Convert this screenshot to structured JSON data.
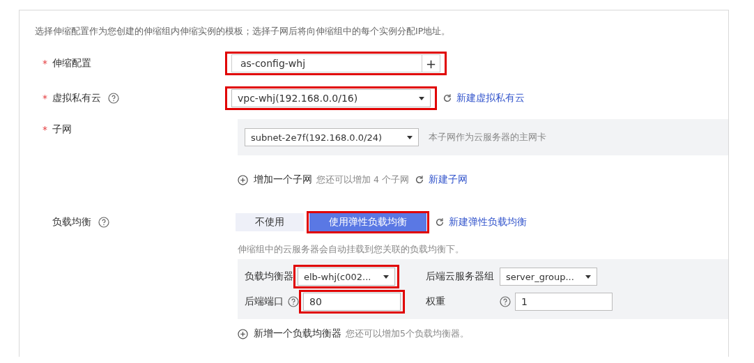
{
  "intro": "选择伸缩配置作为您创建的伸缩组内伸缩实例的模板；选择子网后将向伸缩组中的每个实例分配IP地址。",
  "config": {
    "label": "伸缩配置",
    "required_mark": "*",
    "value": "as-config-whj",
    "add": "+",
    "highlighted": true
  },
  "vpc": {
    "label": "虚拟私有云",
    "required_mark": "*",
    "value": "vpc-whj(192.168.0.0/16)",
    "link": "新建虚拟私有云",
    "highlighted": true
  },
  "subnet": {
    "label": "子网",
    "required_mark": "*",
    "value": "subnet-2e7f(192.168.0.0/24)",
    "hint": "本子网作为云服务器的主网卡",
    "add_label": "增加一个子网",
    "add_hint": "您还可以增加 4 个子网",
    "link": "新建子网"
  },
  "load_balance": {
    "label": "负载均衡",
    "options": [
      {
        "label": "不使用",
        "selected": false,
        "highlighted": false
      },
      {
        "label": "使用弹性负载均衡",
        "selected": true,
        "highlighted": true
      }
    ],
    "link": "新建弹性负载均衡",
    "hint": "伸缩组中的云服务器会自动挂载到您关联的负载均衡下。",
    "fields": [
      {
        "kind": "select",
        "label": "负载均衡器",
        "help": false,
        "value": "elb-whj(c002...",
        "highlighted": true
      },
      {
        "kind": "select",
        "label": "后端云服务器组",
        "help": false,
        "value": "server_group...",
        "highlighted": false
      },
      {
        "kind": "input",
        "label": "后端端口",
        "help": true,
        "value": "80",
        "highlighted": true
      },
      {
        "kind": "input",
        "label": "权重",
        "help": true,
        "value": "1",
        "highlighted": false
      }
    ],
    "add_label": "新增一个负载均衡器",
    "add_hint": "您还可以增加5个负载均衡器。"
  }
}
